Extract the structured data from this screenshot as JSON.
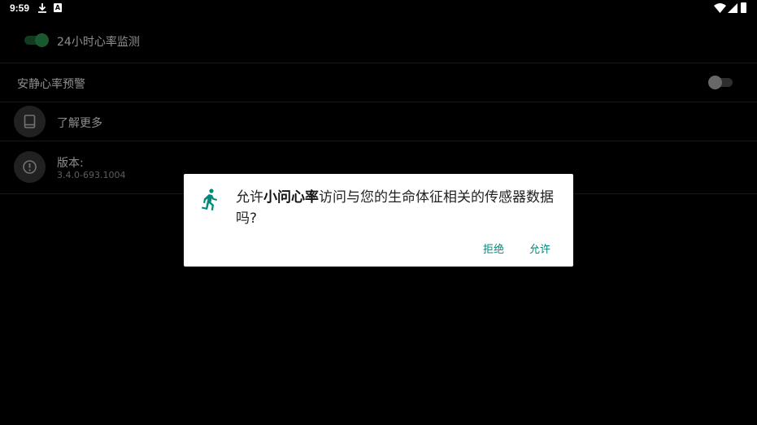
{
  "status_bar": {
    "time": "9:59",
    "notification_icons": [
      "download-icon",
      "a-icon"
    ],
    "system_icons": [
      "wifi-icon",
      "cell-signal-icon",
      "battery-icon"
    ]
  },
  "settings": {
    "hr24": {
      "label": "24小时心率监测",
      "enabled": true
    },
    "quiet_alert": {
      "label": "安静心率预警",
      "enabled": false
    },
    "learn_more": {
      "label": "了解更多",
      "icon": "book-icon"
    },
    "version": {
      "label": "版本:",
      "value": "3.4.0-693.1004",
      "icon": "info-icon"
    }
  },
  "dialog": {
    "icon": "running-person-icon",
    "message_prefix": "允许",
    "app_name": "小问心率",
    "message_suffix": "访问与您的生命体征相关的传感器数据吗?",
    "deny_label": "拒绝",
    "allow_label": "允许"
  },
  "colors": {
    "accent": "#00897b",
    "toggle_on": "#2fa352",
    "background": "#000000"
  }
}
